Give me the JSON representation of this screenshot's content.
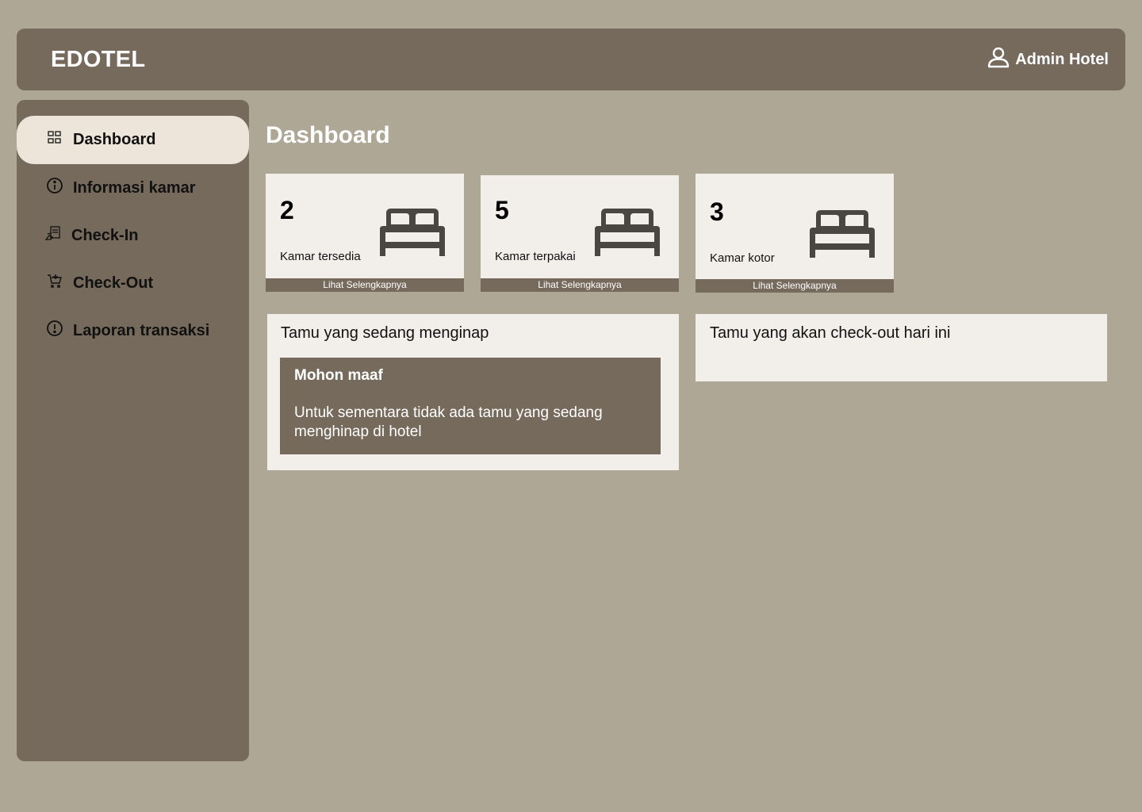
{
  "header": {
    "brand": "EDOTEL",
    "user_label": "Admin Hotel",
    "user_icon": "user-icon"
  },
  "sidebar": {
    "items": [
      {
        "label": "Dashboard",
        "icon": "grid-icon",
        "active": true
      },
      {
        "label": "Informasi kamar",
        "icon": "info-icon",
        "active": false
      },
      {
        "label": "Check-In",
        "icon": "check-in-icon",
        "active": false
      },
      {
        "label": "Check-Out",
        "icon": "cart-icon",
        "active": false
      },
      {
        "label": "Laporan transaksi",
        "icon": "alert-circle-icon",
        "active": false
      }
    ]
  },
  "main": {
    "title": "Dashboard",
    "stats": [
      {
        "value": "2",
        "label": "Kamar tersedia",
        "link": "Lihat Selengkapnya",
        "icon": "bed-icon"
      },
      {
        "value": "5",
        "label": "Kamar terpakai",
        "link": "Lihat Selengkapnya",
        "icon": "bed-icon"
      },
      {
        "value": "3",
        "label": "Kamar kotor",
        "link": "Lihat Selengkapnya",
        "icon": "bed-icon"
      }
    ],
    "panels": {
      "staying": {
        "title": "Tamu yang sedang menginap",
        "notice_title": "Mohon maaf",
        "notice_text": "Untuk sementara tidak ada tamu yang sedang menghinap di hotel"
      },
      "checkout": {
        "title": "Tamu yang akan check-out hari ini"
      }
    }
  },
  "colors": {
    "background": "#afa795",
    "primary": "#766a5c",
    "card": "#f2eeea",
    "active_nav": "#ede5d9",
    "icon_dark": "#4a4642"
  }
}
